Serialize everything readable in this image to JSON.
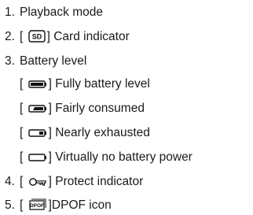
{
  "items": [
    {
      "num": "1.",
      "text": "Playback mode"
    },
    {
      "num": "2.",
      "pre": "[",
      "icon": "sd-card-icon",
      "post": "] Card indicator"
    },
    {
      "num": "3.",
      "text": "Battery level"
    },
    {
      "num": "4.",
      "pre": "[",
      "icon": "protect-key-icon",
      "post": "] Protect indicator"
    },
    {
      "num": "5.",
      "pre": "[",
      "icon": "dpof-icon",
      "post": "]DPOF icon"
    }
  ],
  "battery_levels": [
    {
      "pre": "[",
      "icon": "battery-full-icon",
      "level": 1.0,
      "post": "] Fully battery level"
    },
    {
      "pre": "[",
      "icon": "battery-fair-icon",
      "level": 0.7,
      "post": "] Fairly consumed"
    },
    {
      "pre": "[",
      "icon": "battery-low-icon",
      "level": 0.3,
      "post": "] Nearly exhausted"
    },
    {
      "pre": "[",
      "icon": "battery-empty-icon",
      "level": 0.0,
      "post": "] Virtually no battery power"
    }
  ],
  "sd_label": "SD",
  "dpof_label": "DPOF"
}
